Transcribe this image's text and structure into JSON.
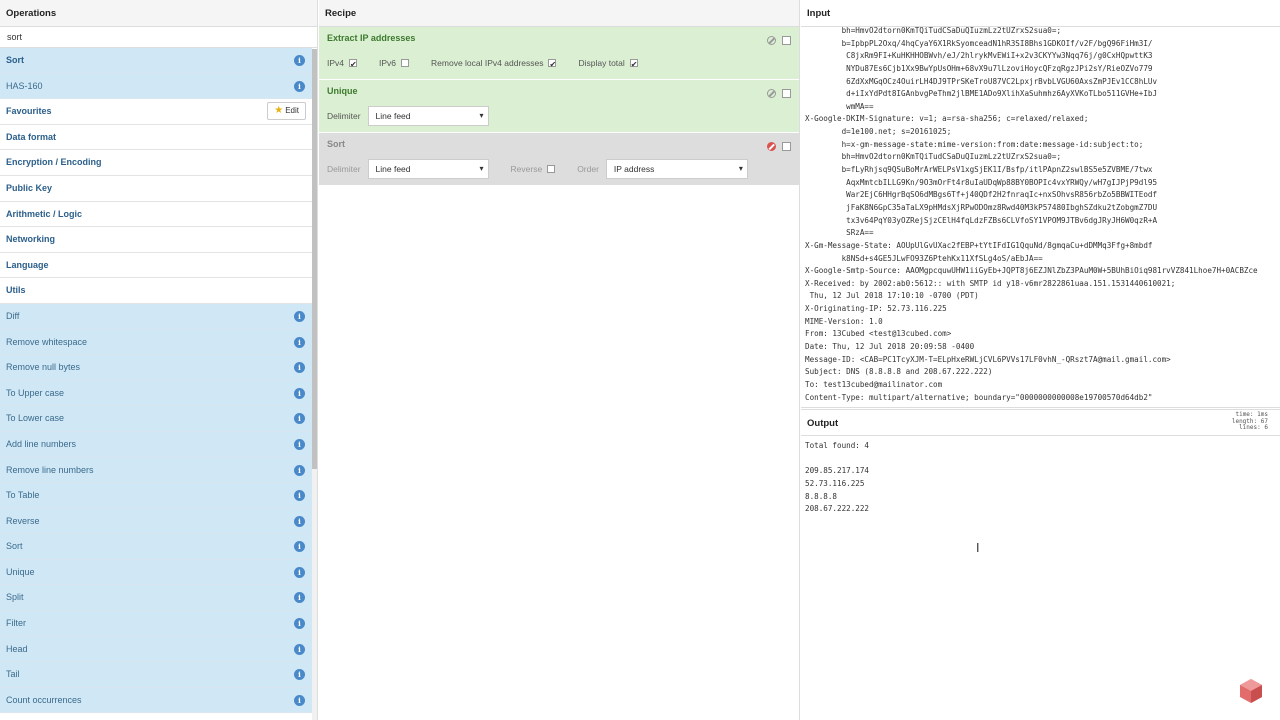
{
  "operations": {
    "title": "Operations",
    "search_value": "sort",
    "top_results": [
      {
        "label": "Sort",
        "bold": true
      },
      {
        "label": "HAS-160",
        "bold": false
      }
    ],
    "categories": [
      "Favourites",
      "Data format",
      "Encryption / Encoding",
      "Public Key",
      "Arithmetic / Logic",
      "Networking",
      "Language",
      "Utils"
    ],
    "edit_label": "Edit",
    "utils_items": [
      "Diff",
      "Remove whitespace",
      "Remove null bytes",
      "To Upper case",
      "To Lower case",
      "Add line numbers",
      "Remove line numbers",
      "To Table",
      "Reverse",
      "Sort",
      "Unique",
      "Split",
      "Filter",
      "Head",
      "Tail",
      "Count occurrences"
    ]
  },
  "recipe": {
    "title": "Recipe",
    "ops": [
      {
        "name": "Extract IP addresses",
        "args": {
          "ipv4": "IPv4",
          "ipv4_checked": true,
          "ipv6": "IPv6",
          "ipv6_checked": false,
          "remove_local": "Remove local IPv4 addresses",
          "remove_local_checked": true,
          "display_total": "Display total",
          "display_total_checked": true
        }
      },
      {
        "name": "Unique",
        "delimiter_label": "Delimiter",
        "delimiter_value": "Line feed"
      },
      {
        "name": "Sort",
        "delimiter_label": "Delimiter",
        "delimiter_value": "Line feed",
        "reverse_label": "Reverse",
        "order_label": "Order",
        "order_value": "IP address"
      }
    ]
  },
  "input": {
    "title": "Input",
    "lines": [
      "        bh=HmvO2dtorn0KmTQiTudCSaDuQIuzmLz2tUZrxS2sua0=;",
      "        b=IpbpPL2Oxq/4hqCyaY6X1RkSyomceadN1hR3SI8Bhs1GDKOIf/v2F/bgQ96FiHm3I/",
      "         C8jxRm9FI+KuHKHHOBWvh/eJ/2hlrykMvEWiI+x2v3CKYYw3Nqq76j/g0CxHQpwttK3",
      "         NYDu87Es6Cjb1Xx9BwYpUsOHm+68vX9u7lLzoviHoycQFzqRgzJPi2sY/RieOZVo779",
      "         6ZdXxMGqOCz4OuirLH4DJ9TPrSKeTroU87VC2LpxjrBvbLVGU60AxsZmPJEv1CC8hLUv",
      "         d+iIxYdPdt8IGAnbvgPeThm2jlBME1ADo9XlihXaSuhmhz6AyXVKoTLbo511GVHe+IbJ",
      "         wmMA==",
      "X-Google-DKIM-Signature: v=1; a=rsa-sha256; c=relaxed/relaxed;",
      "        d=1e100.net; s=20161025;",
      "        h=x-gm-message-state:mime-version:from:date:message-id:subject:to;",
      "        bh=HmvO2dtorn0KmTQiTudCSaDuQIuzmLz2tUZrxS2sua0=;",
      "        b=fLyRhjsq9QSuBoMrArWELPsV1xgSjEK1I/Bsfp/itlPApnZ2swlBS5e5ZVBME/7twx",
      "         AqxMmtcbILLG9Kn/9O3mOrFt4r8uIaUDqWp88BY0BOPIc4vxYRWQy/wH7gIJPjP9dl95",
      "         War2EjC6HHgrBqSO6dMBgs6Tf+j40QDf2H2fnraqIc+nxSOhvsR856rbZo5BBWITEodf",
      "         jFaK8N6GpC35aTaLX9pHMdsXjRPwODOmz8Rwd40M3kP57480IbghSZdku2tZobgmZ7DU",
      "         tx3v64PqY03yOZRejSjzCElH4fqLdzFZBs6CLVfoSY1VPOM9JTBv6dgJRyJH6W0qzR+A",
      "         SRzA==",
      "X-Gm-Message-State: AOUpUlGvUXac2fEBP+tYtIFdIG1QquNd/8gmqaCu+dDMMq3Ffg+8mbdf",
      "        k8NSd+s4GE5JLwFO93Z6PtehKx11XfSLg4oS/aEbJA==",
      "X-Google-Smtp-Source: AAOMgpcquwUHW1iiGyEb+JQPT8j6EZJNlZbZ3PAuM0W+5BUhBiOiq981rvVZ841Lhoe7H+0ACBZce",
      "X-Received: by 2002:ab0:5612:: with SMTP id y18-v6mr2822861uaa.151.1531440610021;",
      " Thu, 12 Jul 2018 17:10:10 -0700 (PDT)",
      "X-Originating-IP: 52.73.116.225",
      "MIME-Version: 1.0",
      "From: 13Cubed <test@13cubed.com>",
      "Date: Thu, 12 Jul 2018 20:09:58 -0400",
      "Message-ID: <CAB=PC1TcyXJM-T=ELpHxeRWLjCVL6PVVs17LF0vhN_-QRszt7A@mail.gmail.com>",
      "Subject: DNS (8.8.8.8 and 208.67.222.222)",
      "To: test13cubed@mailinator.com",
      "Content-Type: multipart/alternative; boundary=\"0000000000008e19700570d64db2\""
    ]
  },
  "output": {
    "title": "Output",
    "stats": {
      "time_label": "time:",
      "time_value": "1ms",
      "length_label": "length:",
      "length_value": "67",
      "lines_label": "lines:",
      "lines_value": "6"
    },
    "lines": [
      "Total found: 4",
      "",
      "209.85.217.174",
      "52.73.116.225",
      "8.8.8.8",
      "208.67.222.222"
    ]
  },
  "colors": {
    "op_bg": "#d0e8f6",
    "recipe_active": "#dbf0d3",
    "recipe_disabled": "#dddddd",
    "info_icon": "#4a89c9",
    "logo": "#e26b6b"
  },
  "icons": {
    "info": "info-icon",
    "star": "star-icon",
    "disable": "disable-icon",
    "breakpoint": "breakpoint-checkbox",
    "logo": "cyberchef-logo-icon"
  }
}
